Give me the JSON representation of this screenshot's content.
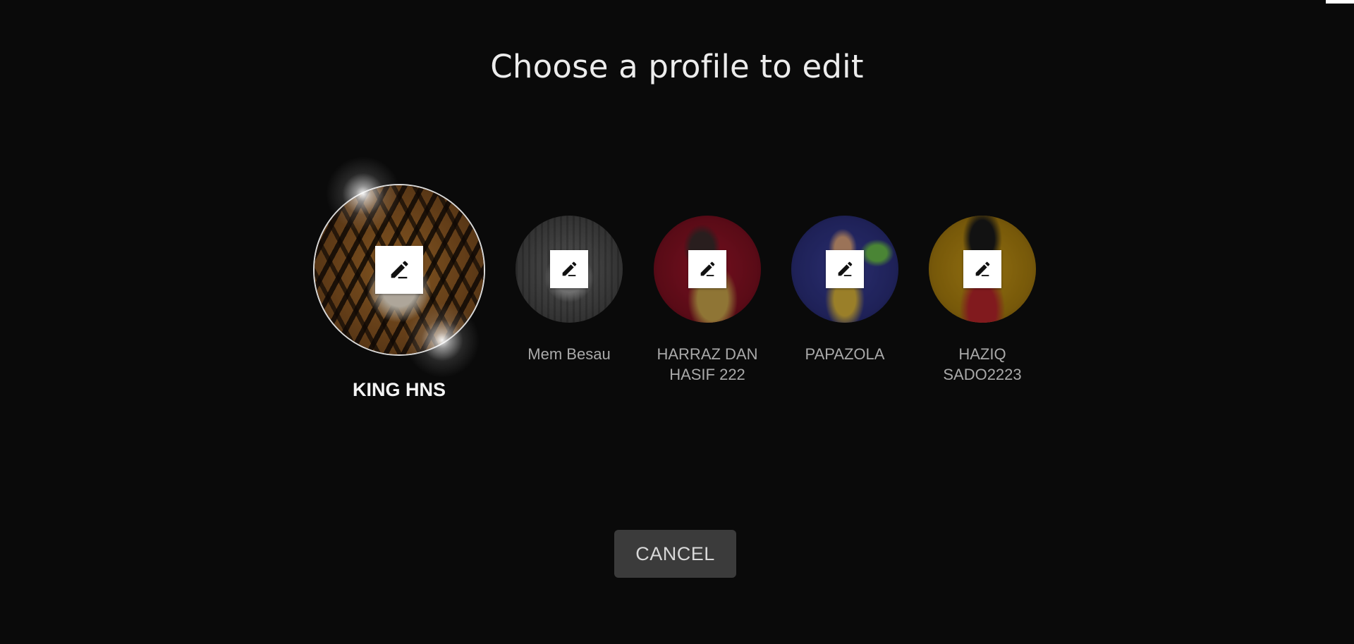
{
  "title": "Choose a profile to edit",
  "profiles": [
    {
      "name": "KING HNS",
      "selected": true,
      "avatar": "tiger-avatar"
    },
    {
      "name": "Mem Besau",
      "selected": false,
      "avatar": "cat-avatar"
    },
    {
      "name": "HARRAZ DAN HASIF 222",
      "selected": false,
      "avatar": "clown-red-avatar"
    },
    {
      "name": "PAPAZOLA",
      "selected": false,
      "avatar": "clown-blue-avatar"
    },
    {
      "name": "HAZIQ SADO2223",
      "selected": false,
      "avatar": "cartoon-yellow-avatar"
    }
  ],
  "cancel_label": "CANCEL",
  "icons": {
    "edit": "pencil-icon"
  },
  "colors": {
    "background": "#0a0a0a",
    "button": "#3b3b3b",
    "edit_box": "#ffffff"
  }
}
